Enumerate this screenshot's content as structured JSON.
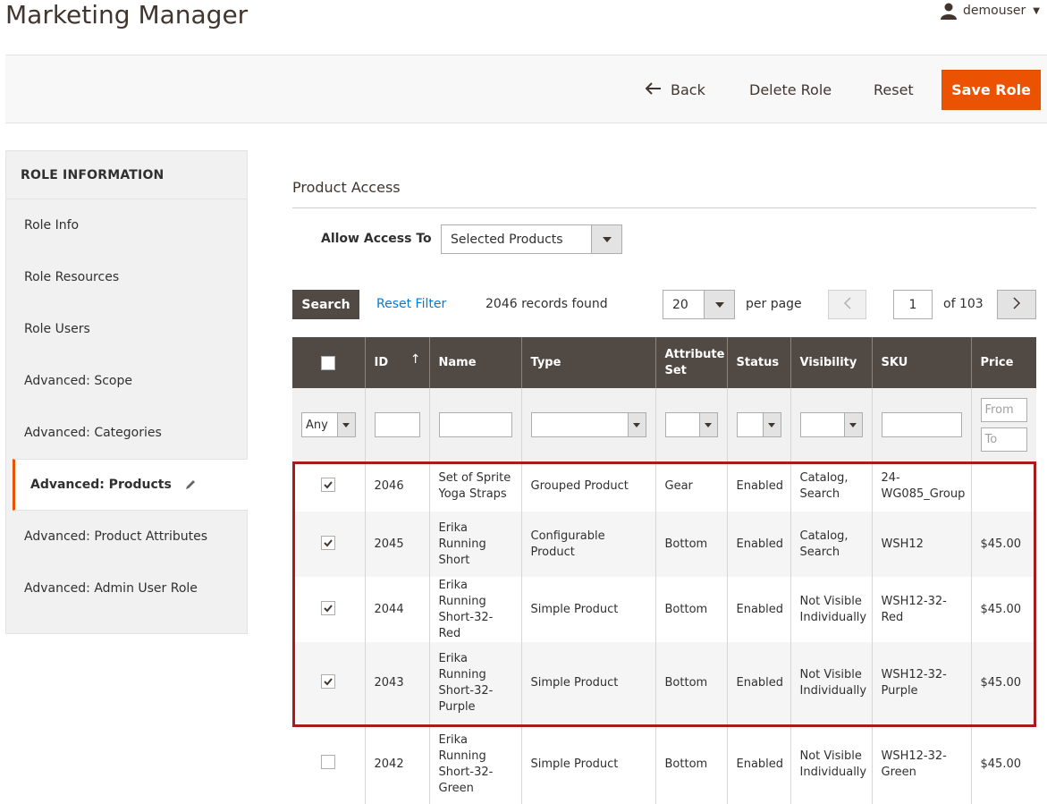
{
  "page": {
    "title": "Marketing Manager",
    "username": "demouser"
  },
  "actions": {
    "back": "Back",
    "delete_role": "Delete Role",
    "reset": "Reset",
    "save_role": "Save Role"
  },
  "sidebar": {
    "title": "ROLE INFORMATION",
    "items": [
      {
        "label": "Role Info"
      },
      {
        "label": "Role Resources"
      },
      {
        "label": "Role Users"
      },
      {
        "label": "Advanced: Scope"
      },
      {
        "label": "Advanced: Categories"
      },
      {
        "label": "Advanced: Products",
        "active": true
      },
      {
        "label": "Advanced: Product Attributes"
      },
      {
        "label": "Advanced: Admin User Role"
      }
    ]
  },
  "section": {
    "title": "Product Access",
    "allow_label": "Allow Access To",
    "allow_value": "Selected Products"
  },
  "toolbar": {
    "search": "Search",
    "reset_filter": "Reset Filter",
    "records": "2046 records found",
    "per_page_value": "20",
    "per_page_label": "per page",
    "page": "1",
    "of_pages": "of 103"
  },
  "grid": {
    "columns": {
      "id": "ID",
      "name": "Name",
      "type": "Type",
      "attribute_set": "Attribute Set",
      "status": "Status",
      "visibility": "Visibility",
      "sku": "SKU",
      "price": "Price"
    },
    "filter": {
      "any": "Any",
      "price_from": "From",
      "price_to": "To"
    },
    "rows": [
      {
        "checked": true,
        "id": "2046",
        "name": "Set of Sprite Yoga Straps",
        "type": "Grouped Product",
        "attribute_set": "Gear",
        "status": "Enabled",
        "visibility": "Catalog, Search",
        "sku": "24-WG085_Group",
        "price": ""
      },
      {
        "checked": true,
        "id": "2045",
        "name": "Erika Running Short",
        "type": "Configurable Product",
        "attribute_set": "Bottom",
        "status": "Enabled",
        "visibility": "Catalog, Search",
        "sku": "WSH12",
        "price": "$45.00"
      },
      {
        "checked": true,
        "id": "2044",
        "name": "Erika Running Short-32-Red",
        "type": "Simple Product",
        "attribute_set": "Bottom",
        "status": "Enabled",
        "visibility": "Not Visible Individually",
        "sku": "WSH12-32-Red",
        "price": "$45.00"
      },
      {
        "checked": true,
        "id": "2043",
        "name": "Erika Running Short-32-Purple",
        "type": "Simple Product",
        "attribute_set": "Bottom",
        "status": "Enabled",
        "visibility": "Not Visible Individually",
        "sku": "WSH12-32-Purple",
        "price": "$45.00"
      },
      {
        "checked": false,
        "id": "2042",
        "name": "Erika Running Short-32-Green",
        "type": "Simple Product",
        "attribute_set": "Bottom",
        "status": "Enabled",
        "visibility": "Not Visible Individually",
        "sku": "WSH12-32-Green",
        "price": "$45.00"
      }
    ]
  },
  "colors": {
    "accent": "#eb5202",
    "header_bg": "#514943",
    "highlight": "#a81b1b",
    "link": "#007bdb"
  },
  "icons": [
    "user-icon",
    "back-arrow-icon",
    "pencil-icon",
    "chevron-left-icon",
    "chevron-right-icon",
    "sort-up-icon",
    "checkmark-icon",
    "dropdown-caret-icon"
  ]
}
